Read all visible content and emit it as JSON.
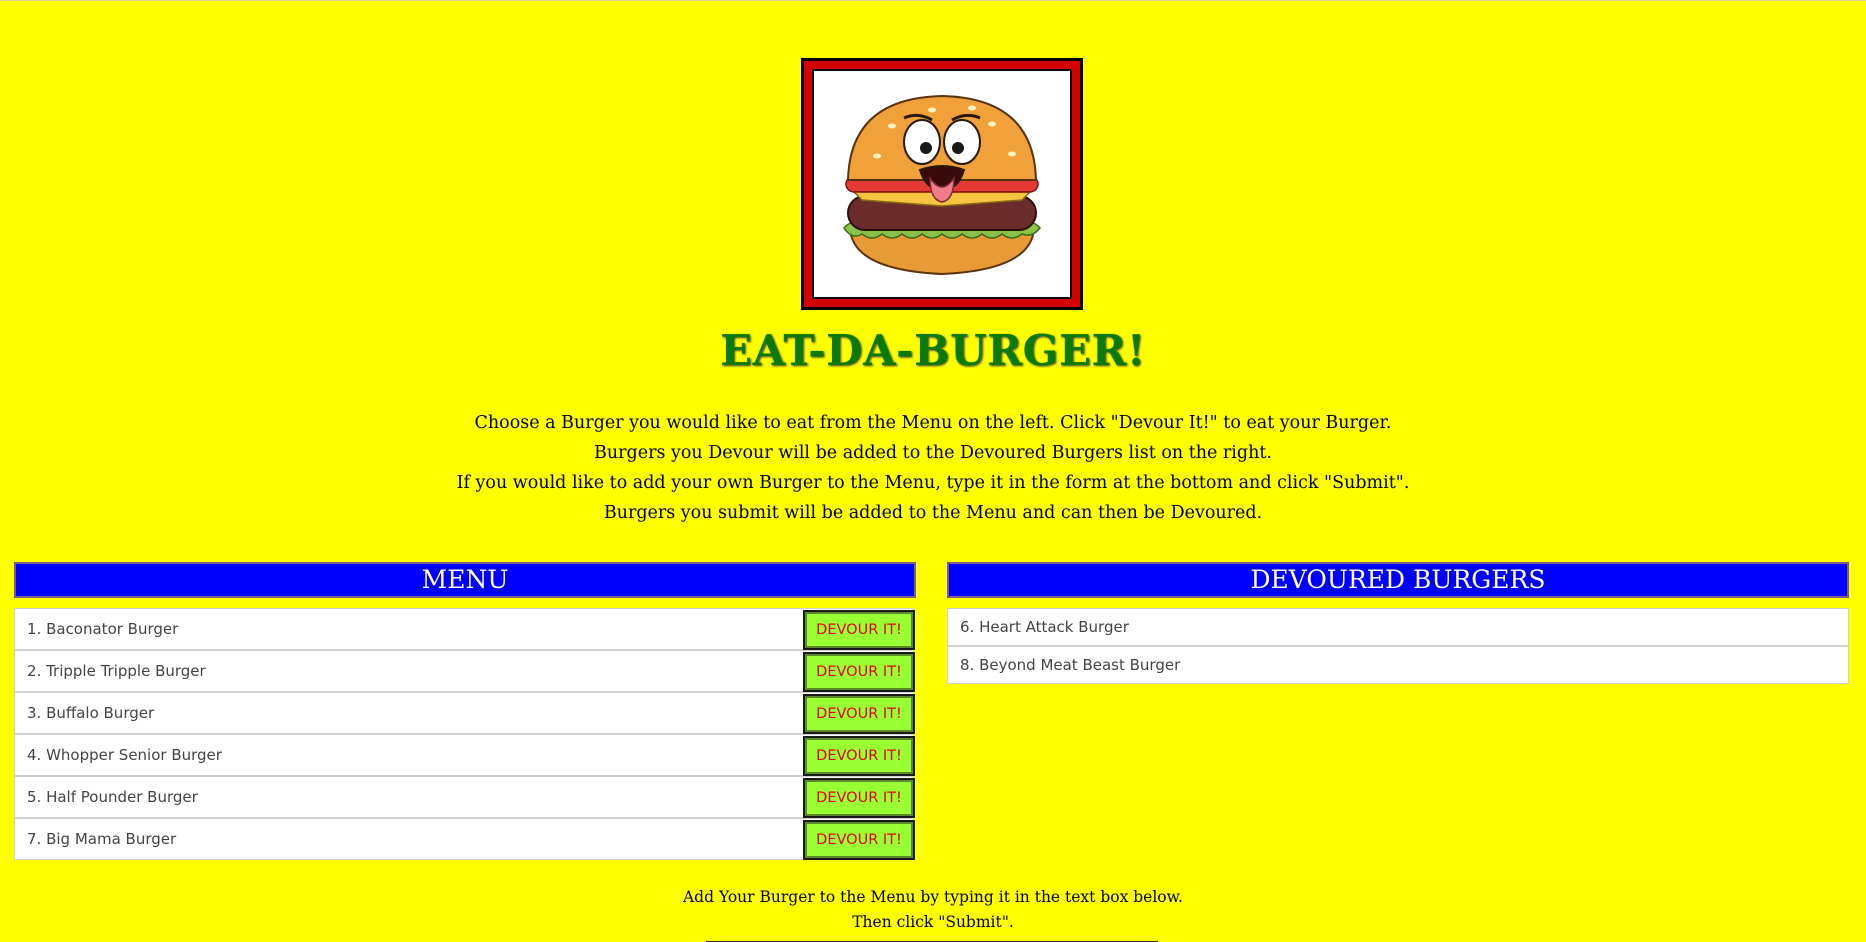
{
  "header": {
    "title": "EAT-DA-BURGER!"
  },
  "intro": {
    "line1": "Choose a Burger you would like to eat from the Menu on the left. Click \"Devour It!\" to eat your Burger.",
    "line2": "Burgers you Devour will be added to the Devoured Burgers list on the right.",
    "line3": "If you would like to add your own Burger to the Menu, type it in the form at the bottom and click \"Submit\".",
    "line4": "Burgers you submit will be added to the Menu and can then be Devoured."
  },
  "menu": {
    "heading": "MENU",
    "button_label": "DEVOUR IT!",
    "items": [
      "1. Baconator Burger",
      "2. Tripple Tripple Burger",
      "3. Buffalo Burger",
      "4. Whopper Senior Burger",
      "5. Half Pounder Burger",
      "7. Big Mama Burger"
    ]
  },
  "devoured": {
    "heading": "DEVOURED BURGERS",
    "items": [
      "6. Heart Attack Burger",
      "8. Beyond Meat Beast Burger"
    ]
  },
  "add_form": {
    "line1": "Add Your Burger to the Menu by typing it in the text box below.",
    "line2": "Then click \"Submit\"."
  },
  "colors": {
    "background": "#ffff00",
    "title": "#0a7a0a",
    "panel_header": "#0000ff",
    "button_bg": "#99ff33",
    "button_text": "#e00000",
    "logo_frame": "#d40000"
  }
}
